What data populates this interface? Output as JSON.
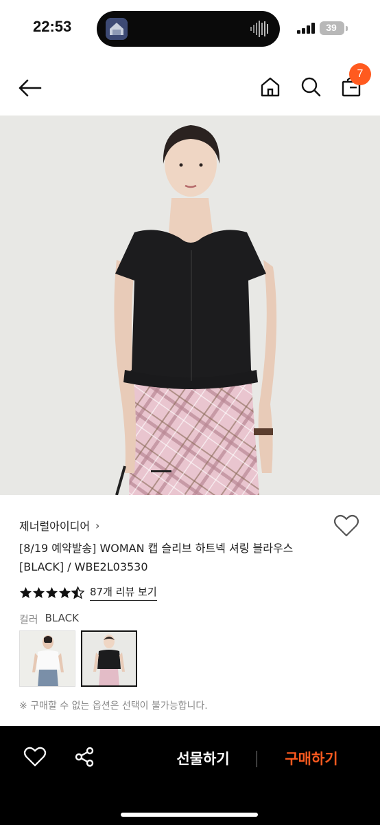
{
  "status_bar": {
    "time": "22:53",
    "battery": "39",
    "icons": [
      "dynamic-island-app-icon",
      "audio-wave-icon",
      "signal-icon",
      "battery-icon"
    ]
  },
  "header": {
    "icons": [
      "back-arrow-icon",
      "home-icon",
      "search-icon",
      "shopping-bag-icon"
    ],
    "cart_count": "7",
    "accent": "#ff5a1f"
  },
  "product": {
    "brand": "제너럴아이디어",
    "brand_chevron": "›",
    "title": "[8/19 예약발송] WOMAN 캡 슬리브 하트넥 셔링 블라우스 [BLACK] / WBE2L03530",
    "rating": 4.5,
    "review_link": "87개 리뷰 보기",
    "color_label": "컬러",
    "color_value": "BLACK",
    "swatches": [
      {
        "name": "white",
        "selected": false
      },
      {
        "name": "black",
        "selected": true
      }
    ],
    "notice": "※ 구매할 수 없는 옵션은 선택이 불가능합니다.",
    "image_index": 1
  },
  "bottom_bar": {
    "gift_label": "선물하기",
    "buy_label": "구매하기",
    "icons": [
      "heart-icon",
      "share-icon"
    ],
    "background": "#000000",
    "buy_color": "#ff5a1f"
  }
}
